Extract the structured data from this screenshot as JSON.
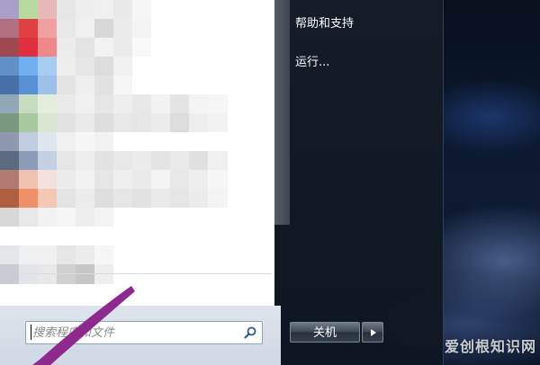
{
  "start_menu": {
    "right_pane": {
      "help_label": "帮助和支持",
      "run_label": "运行..."
    },
    "shutdown_label": "关机",
    "search": {
      "placeholder": "搜索程序和文件"
    }
  },
  "watermark": "爱创根知识网",
  "colors": {
    "right_pane": "#141c28",
    "annotation_arrow": "#8e2a8e"
  }
}
